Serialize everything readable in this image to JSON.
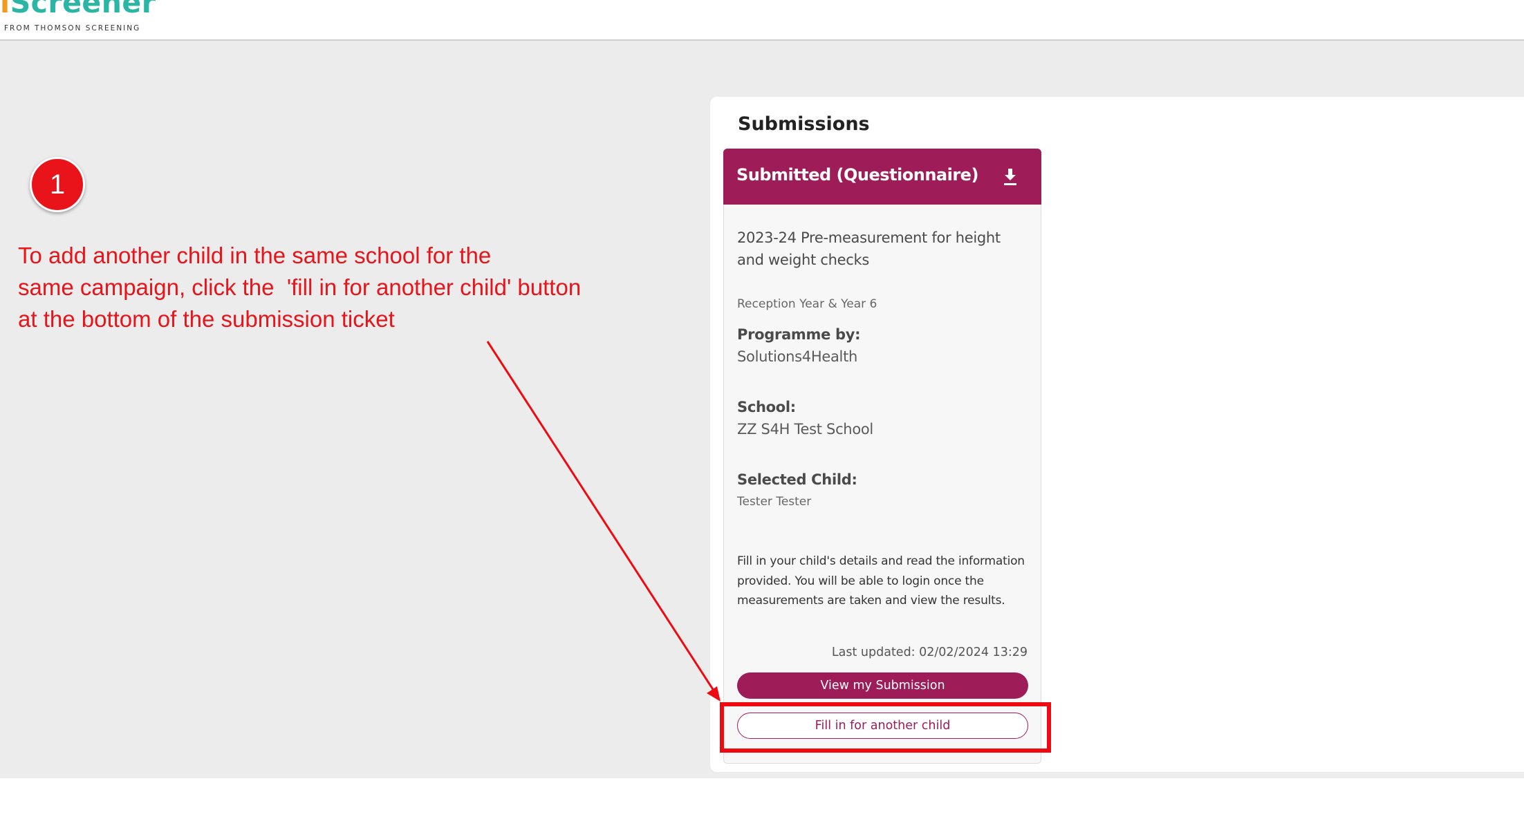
{
  "header": {
    "logo_first_letter": "i",
    "logo_word": "Screener",
    "logo_tagline": "FROM THOMSON SCREENING"
  },
  "annotation": {
    "step_number": "1",
    "instruction_lines": [
      "To add another child in the same school for the",
      "same campaign, click the  'fill in for another child' button",
      "at the bottom of the submission ticket"
    ],
    "color": "#e8141a"
  },
  "submissions": {
    "title": "Submissions",
    "card": {
      "status": "Submitted (Questionnaire)",
      "status_icon": "download-icon",
      "campaign": "2023-24 Pre-measurement for height and weight checks",
      "year_groups": "Reception Year & Year 6",
      "programme_label": "Programme by:",
      "programme_value": "Solutions4Health",
      "school_label": "School:",
      "school_value": "ZZ S4H Test School",
      "child_label": "Selected Child:",
      "child_value": "Tester Tester",
      "description": "Fill in your child's details and read the information provided. You will be able to login once the measurements are taken and view the results.",
      "last_updated": "Last updated: 02/02/2024 13:29",
      "view_button": "View my Submission",
      "fill_button": "Fill in for another child"
    }
  },
  "colors": {
    "brand": "#9e1c58",
    "logo_teal": "#2bb5a4",
    "logo_orange": "#f29a1e",
    "highlight": "#ee0a10"
  }
}
